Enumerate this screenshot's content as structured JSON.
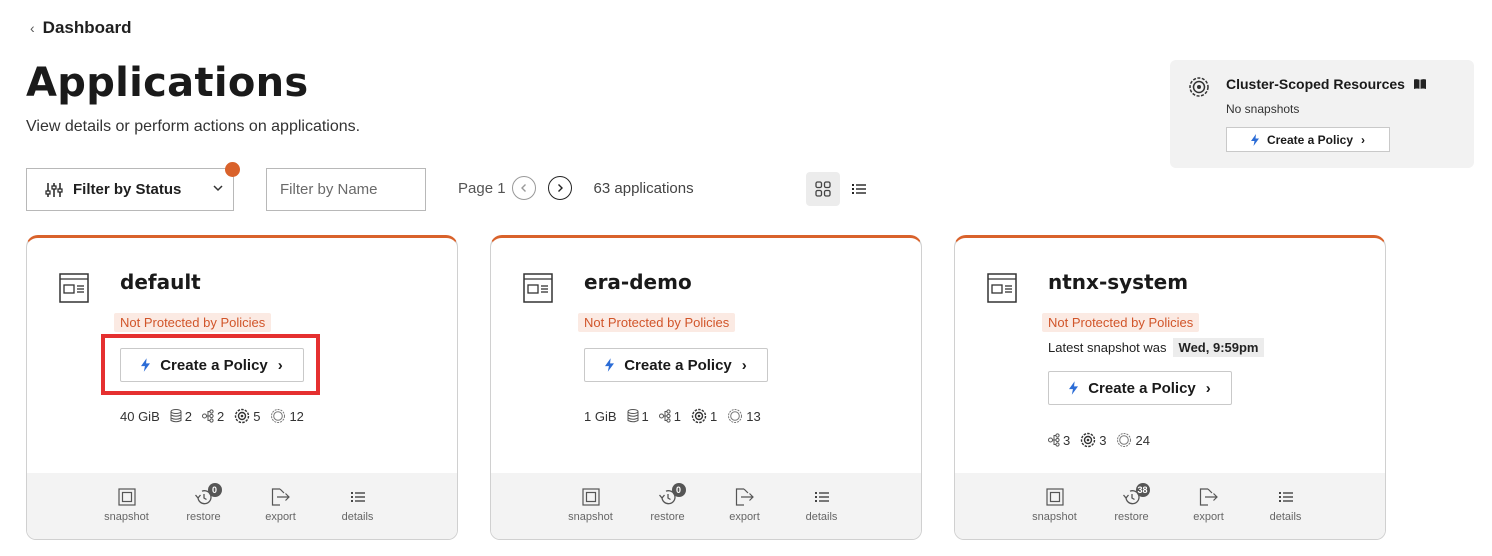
{
  "nav": {
    "back_label": "Dashboard"
  },
  "header": {
    "title": "Applications",
    "subtitle": "View details or perform actions on applications."
  },
  "cluster": {
    "title": "Cluster-Scoped Resources",
    "status": "No snapshots",
    "button_label": "Create a Policy"
  },
  "filters": {
    "status_label": "Filter by Status",
    "name_placeholder": "Filter by Name"
  },
  "pagination": {
    "page_label": "Page 1",
    "count_label": "63 applications"
  },
  "colors": {
    "accent": "#d9622b",
    "badge_text": "#d1552a",
    "badge_bg": "#fbeae3",
    "policy_icon": "#2b6cd6",
    "highlight": "#e53030"
  },
  "apps": [
    {
      "name": "default",
      "status": "Not Protected by Policies",
      "policy_label": "Create a Policy",
      "stats": {
        "size": "40 GiB",
        "volumes": "2",
        "workloads": "2",
        "services": "5",
        "resources": "12"
      },
      "footer": {
        "snapshot": "snapshot",
        "restore": "restore",
        "restore_count": "0",
        "export": "export",
        "details": "details"
      }
    },
    {
      "name": "era-demo",
      "status": "Not Protected by Policies",
      "policy_label": "Create a Policy",
      "stats": {
        "size": "1 GiB",
        "volumes": "1",
        "workloads": "1",
        "services": "1",
        "resources": "13"
      },
      "footer": {
        "snapshot": "snapshot",
        "restore": "restore",
        "restore_count": "0",
        "export": "export",
        "details": "details"
      }
    },
    {
      "name": "ntnx-system",
      "status": "Not Protected by Policies",
      "snapshot_prefix": "Latest snapshot was",
      "snapshot_value": "Wed, 9:59pm",
      "policy_label": "Create a Policy",
      "stats": {
        "workloads": "3",
        "services": "3",
        "resources": "24"
      },
      "footer": {
        "snapshot": "snapshot",
        "restore": "restore",
        "restore_count": "38",
        "export": "export",
        "details": "details"
      }
    }
  ]
}
